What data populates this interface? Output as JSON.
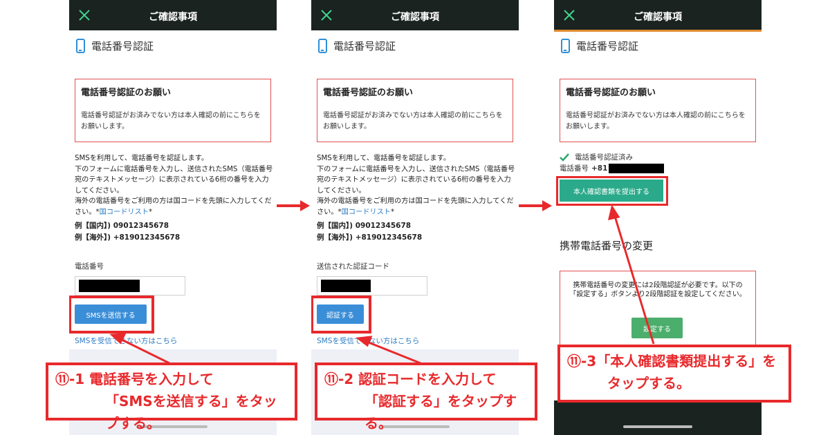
{
  "header": {
    "title": "ご確認事項",
    "close_icon": "close-icon"
  },
  "section": {
    "title": "電話番号認証",
    "icon": "smartphone-icon"
  },
  "notice": {
    "title": "電話番号認証のお願い",
    "body": "電話番号認証がお済みでない方は本人確認の前にこちらをお願いします。"
  },
  "instructions": {
    "line1": "SMSを利用して、電話番号を認証します。",
    "line2": "下のフォームに電話番号を入力し、送信されたSMS（電話番号宛のテキストメッセージ）に表示されている6桁の番号を入力してください。",
    "line3_prefix": "海外の電話番号をご利用の方は国コードを先頭に入力してください。*",
    "country_link": "国コードリスト",
    "line3_suffix": "*",
    "example_domestic": "例【国内】) 09012345678",
    "example_overseas": "例【海外】) +819012345678"
  },
  "screen1": {
    "field_label": "電話番号",
    "button": "SMSを送信する",
    "sms_link": "SMSを受信できない方はこちら"
  },
  "screen2": {
    "field_label": "送信された認証コード",
    "button": "認証する",
    "sms_link": "SMSを受信できない方はこちら"
  },
  "screen3": {
    "verified": "電話番号認証済み",
    "phone_label": "電話番号",
    "phone_prefix": "+81",
    "submit_button": "本人確認書類を提出する",
    "change_title": "携帯電話番号の変更",
    "change_body": "携帯電話番号の変更には2段階認証が必要です。以下の「設定する」ボタンより2段階認証を設定してください。",
    "settings_button": "設定する"
  },
  "callouts": {
    "c1_line1": "⑪-1 電話番号を入力して",
    "c1_line2": "「SMSを送信する」をタップする。",
    "c2_line1": "⑪-2 認証コードを入力して",
    "c2_line2": "「認証する」をタップする。",
    "c3_line1": "⑪-3「本人確認書類提出する」を",
    "c3_line2": "タップする。"
  },
  "colors": {
    "accent_red": "#e8292c",
    "header_dark": "#1a2320",
    "link_blue": "#2a7bc4",
    "button_blue": "#3a8ed8",
    "button_teal": "#2aaa8a",
    "button_green": "#4cae6c"
  }
}
